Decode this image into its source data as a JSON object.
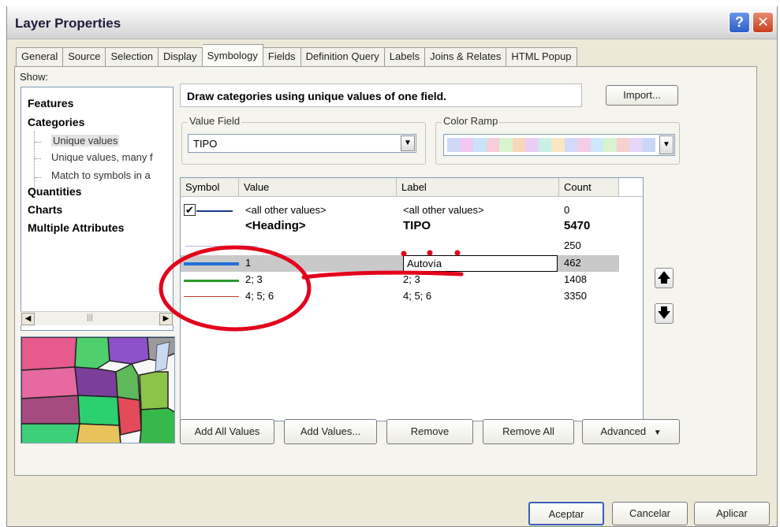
{
  "window": {
    "title": "Layer Properties",
    "help_label": "?",
    "close_label": "✕"
  },
  "tabs": [
    "General",
    "Source",
    "Selection",
    "Display",
    "Symbology",
    "Fields",
    "Definition Query",
    "Labels",
    "Joins & Relates",
    "HTML Popup"
  ],
  "active_tab": "Symbology",
  "show": {
    "label": "Show:",
    "items": [
      "Features",
      "Categories",
      "Unique values",
      "Unique values, many f",
      "Match to symbols in a",
      "Quantities",
      "Charts",
      "Multiple Attributes"
    ]
  },
  "instruction": "Draw categories using unique values of one field.",
  "import_label": "Import...",
  "value_field": {
    "label": "Value Field",
    "value": "TIPO"
  },
  "color_ramp": {
    "label": "Color Ramp",
    "colors": [
      "#cfd7f7",
      "#f1c7f2",
      "#c7e4fb",
      "#f7cdd9",
      "#d8f4ce",
      "#f8d7b8",
      "#e7cef7",
      "#c8f0e7",
      "#fbe6c3",
      "#d4d9f8",
      "#f3cde7",
      "#cae9fc",
      "#d9f2cf",
      "#f6d0cf",
      "#e6d6f7",
      "#c9d6f6"
    ]
  },
  "grid": {
    "headers": [
      "Symbol",
      "Value",
      "Label",
      "Count"
    ],
    "rows": [
      {
        "value": "<all other values>",
        "label": "<all other values>",
        "count": "0",
        "symbol_color": "#1e3a8a",
        "checkbox": "✔"
      },
      {
        "value": "<Heading>",
        "label": "TIPO",
        "count": "5470"
      },
      {
        "value": "",
        "label": "",
        "count": "250",
        "symbol_color": "#b9b0e8"
      },
      {
        "value": "1",
        "label": "Autovía",
        "count": "462",
        "symbol_color": "#1f6fd6"
      },
      {
        "value": "2; 3",
        "label": "2; 3",
        "count": "1408",
        "symbol_color": "#2e9a2e"
      },
      {
        "value": "4; 5; 6",
        "label": "4; 5; 6",
        "count": "3350",
        "symbol_color": "#c0392b"
      }
    ]
  },
  "buttons": {
    "add_all": "Add All Values",
    "add_values": "Add Values...",
    "remove": "Remove",
    "remove_all": "Remove All",
    "advanced": "Advanced",
    "up": "🡅",
    "down": "🡇"
  },
  "footer": {
    "ok": "Aceptar",
    "cancel": "Cancelar",
    "apply": "Aplicar"
  },
  "colors": {
    "annotation": "#e3001b"
  }
}
